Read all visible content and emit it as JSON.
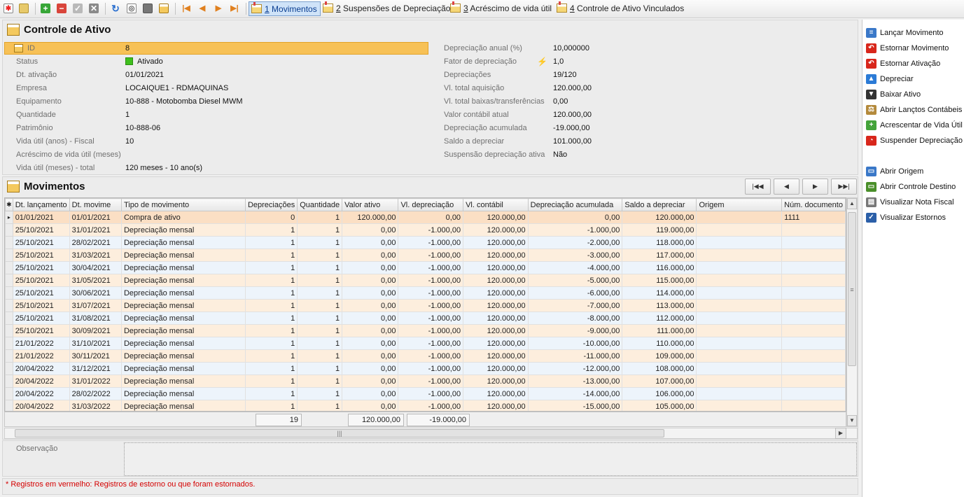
{
  "toolbar": {
    "tabs": [
      {
        "num": "1",
        "label": " Movimentos"
      },
      {
        "num": "2",
        "label": " Suspensões de Depreciação"
      },
      {
        "num": "3",
        "label": " Acréscimo de vida útil"
      },
      {
        "num": "4",
        "label": " Controle de Ativo Vinculados"
      }
    ]
  },
  "form": {
    "title": "Controle de Ativo",
    "left": [
      {
        "label": "ID",
        "value": "8"
      },
      {
        "label": "Status",
        "value": "Ativado"
      },
      {
        "label": "Dt. ativação",
        "value": "01/01/2021"
      },
      {
        "label": "Empresa",
        "value": "LOCAIQUE1 - RDMAQUINAS"
      },
      {
        "label": "Equipamento",
        "value": "10-888 - Motobomba Diesel MWM"
      },
      {
        "label": "Quantidade",
        "value": "1"
      },
      {
        "label": "Patrimônio",
        "value": "10-888-06"
      },
      {
        "label": "Vida útil (anos) - Fiscal",
        "value": "10"
      },
      {
        "label": "Acréscimo de vida útil (meses)",
        "value": ""
      },
      {
        "label": "Vida útil (meses) - total",
        "value": "120 meses - 10 ano(s)"
      }
    ],
    "right": [
      {
        "label": "Depreciação anual (%)",
        "value": "10,000000"
      },
      {
        "label": "Fator de depreciação",
        "value": "1,0"
      },
      {
        "label": "Depreciações",
        "value": "19/120"
      },
      {
        "label": "Vl. total aquisição",
        "value": "120.000,00"
      },
      {
        "label": "Vl. total baixas/transferências",
        "value": "0,00"
      },
      {
        "label": "Valor contábil atual",
        "value": "120.000,00"
      },
      {
        "label": "Depreciação acumulada",
        "value": "-19.000,00"
      },
      {
        "label": "Saldo a depreciar",
        "value": "101.000,00"
      },
      {
        "label": "Suspensão depreciação ativa",
        "value": "Não"
      }
    ]
  },
  "movimentos": {
    "title": "Movimentos",
    "columns": [
      "Dt. lançamento",
      "Dt. movime",
      "Tipo de movimento",
      "Depreciações",
      "Quantidade",
      "Valor ativo",
      "Vl. depreciação",
      "Vl. contábil",
      "Depreciação acumulada",
      "Saldo a depreciar",
      "Origem",
      "Núm. documento"
    ],
    "rows": [
      [
        "01/01/2021",
        "01/01/2021",
        "Compra de ativo",
        "0",
        "1",
        "120.000,00",
        "0,00",
        "120.000,00",
        "0,00",
        "120.000,00",
        "",
        "1111"
      ],
      [
        "25/10/2021",
        "31/01/2021",
        "Depreciação mensal",
        "1",
        "1",
        "0,00",
        "-1.000,00",
        "120.000,00",
        "-1.000,00",
        "119.000,00",
        "",
        ""
      ],
      [
        "25/10/2021",
        "28/02/2021",
        "Depreciação mensal",
        "1",
        "1",
        "0,00",
        "-1.000,00",
        "120.000,00",
        "-2.000,00",
        "118.000,00",
        "",
        ""
      ],
      [
        "25/10/2021",
        "31/03/2021",
        "Depreciação mensal",
        "1",
        "1",
        "0,00",
        "-1.000,00",
        "120.000,00",
        "-3.000,00",
        "117.000,00",
        "",
        ""
      ],
      [
        "25/10/2021",
        "30/04/2021",
        "Depreciação mensal",
        "1",
        "1",
        "0,00",
        "-1.000,00",
        "120.000,00",
        "-4.000,00",
        "116.000,00",
        "",
        ""
      ],
      [
        "25/10/2021",
        "31/05/2021",
        "Depreciação mensal",
        "1",
        "1",
        "0,00",
        "-1.000,00",
        "120.000,00",
        "-5.000,00",
        "115.000,00",
        "",
        ""
      ],
      [
        "25/10/2021",
        "30/06/2021",
        "Depreciação mensal",
        "1",
        "1",
        "0,00",
        "-1.000,00",
        "120.000,00",
        "-6.000,00",
        "114.000,00",
        "",
        ""
      ],
      [
        "25/10/2021",
        "31/07/2021",
        "Depreciação mensal",
        "1",
        "1",
        "0,00",
        "-1.000,00",
        "120.000,00",
        "-7.000,00",
        "113.000,00",
        "",
        ""
      ],
      [
        "25/10/2021",
        "31/08/2021",
        "Depreciação mensal",
        "1",
        "1",
        "0,00",
        "-1.000,00",
        "120.000,00",
        "-8.000,00",
        "112.000,00",
        "",
        ""
      ],
      [
        "25/10/2021",
        "30/09/2021",
        "Depreciação mensal",
        "1",
        "1",
        "0,00",
        "-1.000,00",
        "120.000,00",
        "-9.000,00",
        "111.000,00",
        "",
        ""
      ],
      [
        "21/01/2022",
        "31/10/2021",
        "Depreciação mensal",
        "1",
        "1",
        "0,00",
        "-1.000,00",
        "120.000,00",
        "-10.000,00",
        "110.000,00",
        "",
        ""
      ],
      [
        "21/01/2022",
        "30/11/2021",
        "Depreciação mensal",
        "1",
        "1",
        "0,00",
        "-1.000,00",
        "120.000,00",
        "-11.000,00",
        "109.000,00",
        "",
        ""
      ],
      [
        "20/04/2022",
        "31/12/2021",
        "Depreciação mensal",
        "1",
        "1",
        "0,00",
        "-1.000,00",
        "120.000,00",
        "-12.000,00",
        "108.000,00",
        "",
        ""
      ],
      [
        "20/04/2022",
        "31/01/2022",
        "Depreciação mensal",
        "1",
        "1",
        "0,00",
        "-1.000,00",
        "120.000,00",
        "-13.000,00",
        "107.000,00",
        "",
        ""
      ],
      [
        "20/04/2022",
        "28/02/2022",
        "Depreciação mensal",
        "1",
        "1",
        "0,00",
        "-1.000,00",
        "120.000,00",
        "-14.000,00",
        "106.000,00",
        "",
        ""
      ],
      [
        "20/04/2022",
        "31/03/2022",
        "Depreciação mensal",
        "1",
        "1",
        "0,00",
        "-1.000,00",
        "120.000,00",
        "-15.000,00",
        "105.000,00",
        "",
        ""
      ]
    ],
    "totals": {
      "depreciacoes": "19",
      "valor_ativo": "120.000,00",
      "vl_depreciacao": "-19.000,00"
    }
  },
  "observacao": {
    "label": "Observação",
    "value": ""
  },
  "footer": {
    "note": "* Registros em vermelho:  Registros de estorno ou que foram estornados."
  },
  "actions": {
    "group1": [
      {
        "label": "Lançar Movimento",
        "icon": "form-icon",
        "color": "#3a78c8"
      },
      {
        "label": "Estornar Movimento",
        "icon": "undo-icon",
        "color": "#d8261b"
      },
      {
        "label": "Estornar Ativação",
        "icon": "undo-icon",
        "color": "#d8261b"
      },
      {
        "label": "Depreciar",
        "icon": "drop-icon",
        "color": "#2b7bd6"
      },
      {
        "label": "Baixar Ativo",
        "icon": "pin-icon",
        "color": "#333333"
      },
      {
        "label": "Abrir Lançtos Contábeis",
        "icon": "scale-icon",
        "color": "#b48a3c"
      },
      {
        "label": "Acrescentar de Vida Útil",
        "icon": "calendar-add-icon",
        "color": "#44a33a"
      },
      {
        "label": "Suspender Depreciação",
        "icon": "clock-icon",
        "color": "#d8261b"
      }
    ],
    "group2": [
      {
        "label": "Abrir Origem",
        "icon": "window-icon",
        "color": "#3a78c8"
      },
      {
        "label": "Abrir Controle Destino",
        "icon": "window-icon",
        "color": "#4a8f2a"
      },
      {
        "label": "Visualizar Nota Fiscal",
        "icon": "document-icon",
        "color": "#777777"
      },
      {
        "label": "Visualizar Estornos",
        "icon": "checkbox-icon",
        "color": "#2b5fa8"
      }
    ]
  }
}
